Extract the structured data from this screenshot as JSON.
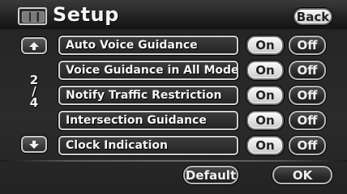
{
  "header": {
    "title": "Setup",
    "back_label": "Back",
    "menu_icon": "menu-grid-icon"
  },
  "scroll": {
    "up_icon": "arrow-up-icon",
    "down_icon": "arrow-down-icon",
    "page_current": "2",
    "page_separator": "/",
    "page_total": "4"
  },
  "settings": [
    {
      "label": "Auto Voice Guidance",
      "on_label": "On",
      "off_label": "Off",
      "selected": "On"
    },
    {
      "label": "Voice Guidance in All Modes",
      "on_label": "On",
      "off_label": "Off",
      "selected": "On"
    },
    {
      "label": "Notify Traffic Restriction",
      "on_label": "On",
      "off_label": "Off",
      "selected": "On"
    },
    {
      "label": "Intersection Guidance",
      "on_label": "On",
      "off_label": "Off",
      "selected": "On"
    },
    {
      "label": "Clock Indication",
      "on_label": "On",
      "off_label": "Off",
      "selected": "On"
    }
  ],
  "footer": {
    "default_label": "Default",
    "ok_label": "OK"
  },
  "colors": {
    "selected_button": "#e6e6e6",
    "unselected_button": "#2a2a2a",
    "background": "#262626"
  }
}
